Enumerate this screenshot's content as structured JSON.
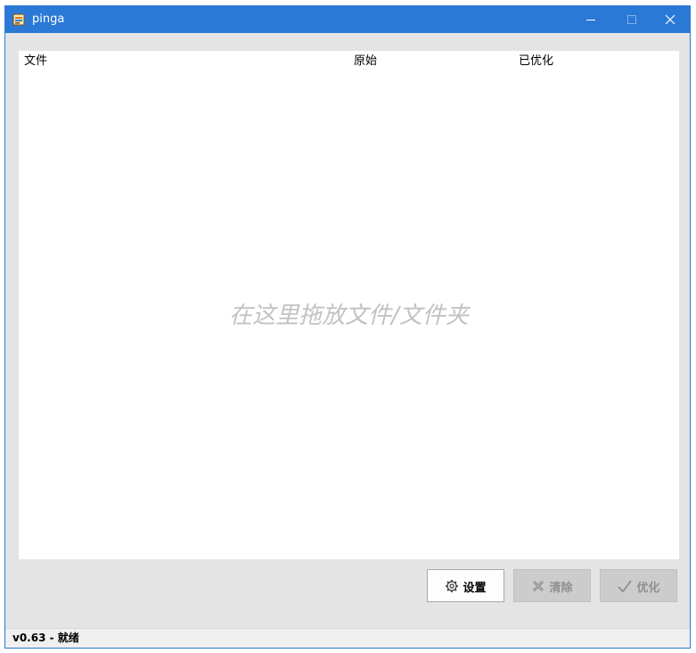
{
  "window": {
    "title": "pinga",
    "accent_color": "#2b79d6"
  },
  "titlebar_buttons": {
    "minimize_icon": "minimize-icon",
    "maximize_icon": "maximize-icon",
    "close_icon": "close-icon"
  },
  "file_list": {
    "columns": [
      "文件",
      "原始",
      "已优化"
    ],
    "rows": [],
    "drop_hint": "在这里拖放文件/文件夹"
  },
  "buttons": {
    "settings": {
      "label": "设置",
      "icon": "gear-icon",
      "enabled": true
    },
    "clear": {
      "label": "清除",
      "icon": "x-icon",
      "enabled": false
    },
    "optimize": {
      "label": "优化",
      "icon": "checkmark-icon",
      "enabled": false
    }
  },
  "statusbar": {
    "text": "v0.63 - 就绪"
  }
}
